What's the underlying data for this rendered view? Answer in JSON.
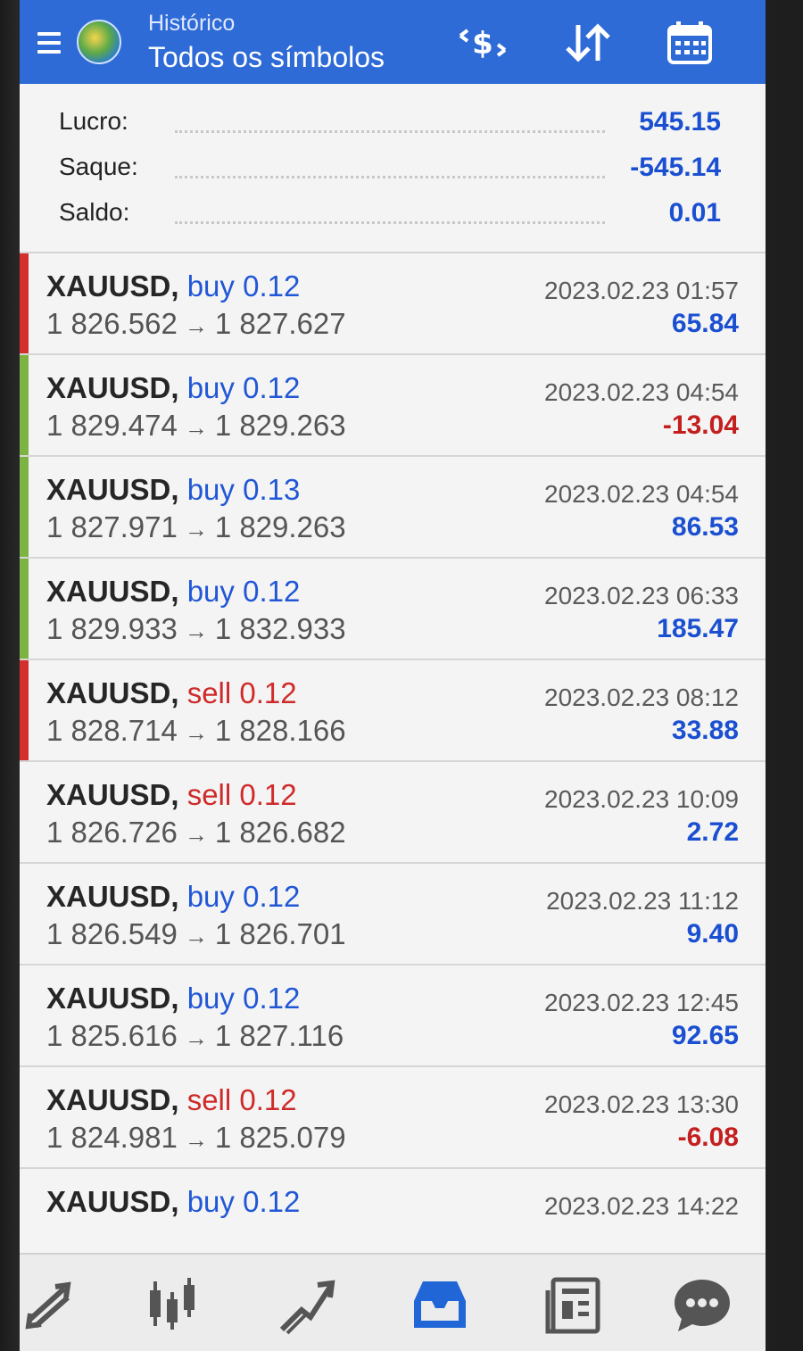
{
  "header": {
    "subtitle": "Histórico",
    "title": "Todos os símbolos",
    "icons": [
      "menu-icon",
      "app-logo",
      "currency-exchange-icon",
      "sort-icon",
      "calendar-icon"
    ]
  },
  "summary": {
    "profit_label": "Lucro:",
    "profit_value": "545.15",
    "withdrawal_label": "Saque:",
    "withdrawal_value": "-545.14",
    "balance_label": "Saldo:",
    "balance_value": "0.01"
  },
  "deals": [
    {
      "symbol": "XAUUSD,",
      "direction": "buy",
      "volume": "0.12",
      "open": "1 826.562",
      "close": "1 827.627",
      "time": "2023.02.23 01:57",
      "profit": "65.84",
      "stripe": "#d32f2f"
    },
    {
      "symbol": "XAUUSD,",
      "direction": "buy",
      "volume": "0.12",
      "open": "1 829.474",
      "close": "1 829.263",
      "time": "2023.02.23 04:54",
      "profit": "-13.04",
      "stripe": "#7cb342"
    },
    {
      "symbol": "XAUUSD,",
      "direction": "buy",
      "volume": "0.13",
      "open": "1 827.971",
      "close": "1 829.263",
      "time": "2023.02.23 04:54",
      "profit": "86.53",
      "stripe": "#7cb342"
    },
    {
      "symbol": "XAUUSD,",
      "direction": "buy",
      "volume": "0.12",
      "open": "1 829.933",
      "close": "1 832.933",
      "time": "2023.02.23 06:33",
      "profit": "185.47",
      "stripe": "#7cb342"
    },
    {
      "symbol": "XAUUSD,",
      "direction": "sell",
      "volume": "0.12",
      "open": "1 828.714",
      "close": "1 828.166",
      "time": "2023.02.23 08:12",
      "profit": "33.88",
      "stripe": "#d32f2f"
    },
    {
      "symbol": "XAUUSD,",
      "direction": "sell",
      "volume": "0.12",
      "open": "1 826.726",
      "close": "1 826.682",
      "time": "2023.02.23 10:09",
      "profit": "2.72",
      "stripe": "#f4f4f4"
    },
    {
      "symbol": "XAUUSD,",
      "direction": "buy",
      "volume": "0.12",
      "open": "1 826.549",
      "close": "1 826.701",
      "time": "2023.02.23 11:12",
      "profit": "9.40",
      "stripe": "#f4f4f4"
    },
    {
      "symbol": "XAUUSD,",
      "direction": "buy",
      "volume": "0.12",
      "open": "1 825.616",
      "close": "1 827.116",
      "time": "2023.02.23 12:45",
      "profit": "92.65",
      "stripe": "#f4f4f4"
    },
    {
      "symbol": "XAUUSD,",
      "direction": "sell",
      "volume": "0.12",
      "open": "1 824.981",
      "close": "1 825.079",
      "time": "2023.02.23 13:30",
      "profit": "-6.08",
      "stripe": "#f4f4f4"
    },
    {
      "symbol": "XAUUSD,",
      "direction": "buy",
      "volume": "0.12",
      "open": "",
      "close": "",
      "time": "2023.02.23 14:22",
      "profit": "",
      "stripe": "#f4f4f4"
    }
  ],
  "arrow_glyph": "→",
  "bottom_nav": [
    {
      "icon": "quotes-icon",
      "active": false
    },
    {
      "icon": "chart-icon",
      "active": false
    },
    {
      "icon": "trade-icon",
      "active": false
    },
    {
      "icon": "history-icon",
      "active": true
    },
    {
      "icon": "news-icon",
      "active": false
    },
    {
      "icon": "chat-icon",
      "active": false
    }
  ],
  "colors": {
    "header_bg": "#2f6bd6",
    "positive": "#1a4fd1",
    "negative": "#c41f1f",
    "buy": "#2157d6",
    "sell": "#cf2a2a",
    "nav_active": "#2166d6",
    "nav_inactive": "#555555"
  }
}
